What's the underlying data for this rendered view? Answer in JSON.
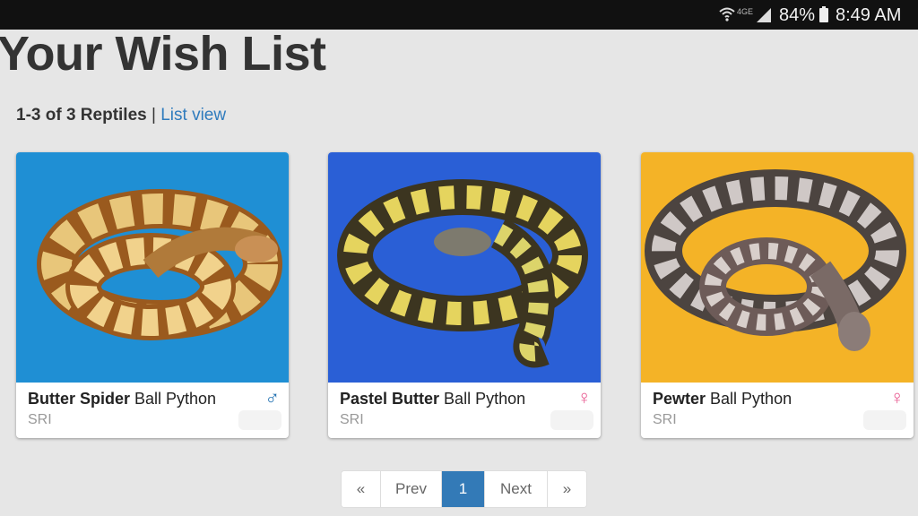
{
  "status_bar": {
    "network": "4GE",
    "battery": "84%",
    "time": "8:49 AM"
  },
  "page": {
    "title": "Your Wish List",
    "count_text": "1-3 of 3 Reptiles",
    "separator": "|",
    "list_view_label": "List view"
  },
  "cards": [
    {
      "morph": "Butter Spider",
      "species": " Ball Python",
      "seller": "SRI",
      "sex_icon": "male-icon",
      "sex_symbol": "♂",
      "bg_color": "#1f8fd4"
    },
    {
      "morph": "Pastel Butter",
      "species": " Ball Python",
      "seller": "SRI",
      "sex_icon": "female-icon",
      "sex_symbol": "♀",
      "bg_color": "#2a5fd6"
    },
    {
      "morph": "Pewter",
      "species": " Ball Python",
      "seller": "SRI",
      "sex_icon": "female-icon",
      "sex_symbol": "♀",
      "bg_color": "#f4b327"
    }
  ],
  "pagination": {
    "first": "«",
    "prev": "Prev",
    "current": "1",
    "next": "Next",
    "last": "»"
  },
  "colors": {
    "accent": "#337ab7",
    "link": "#2f7bbd",
    "male": "#1e6fb0",
    "female": "#e8588f"
  }
}
